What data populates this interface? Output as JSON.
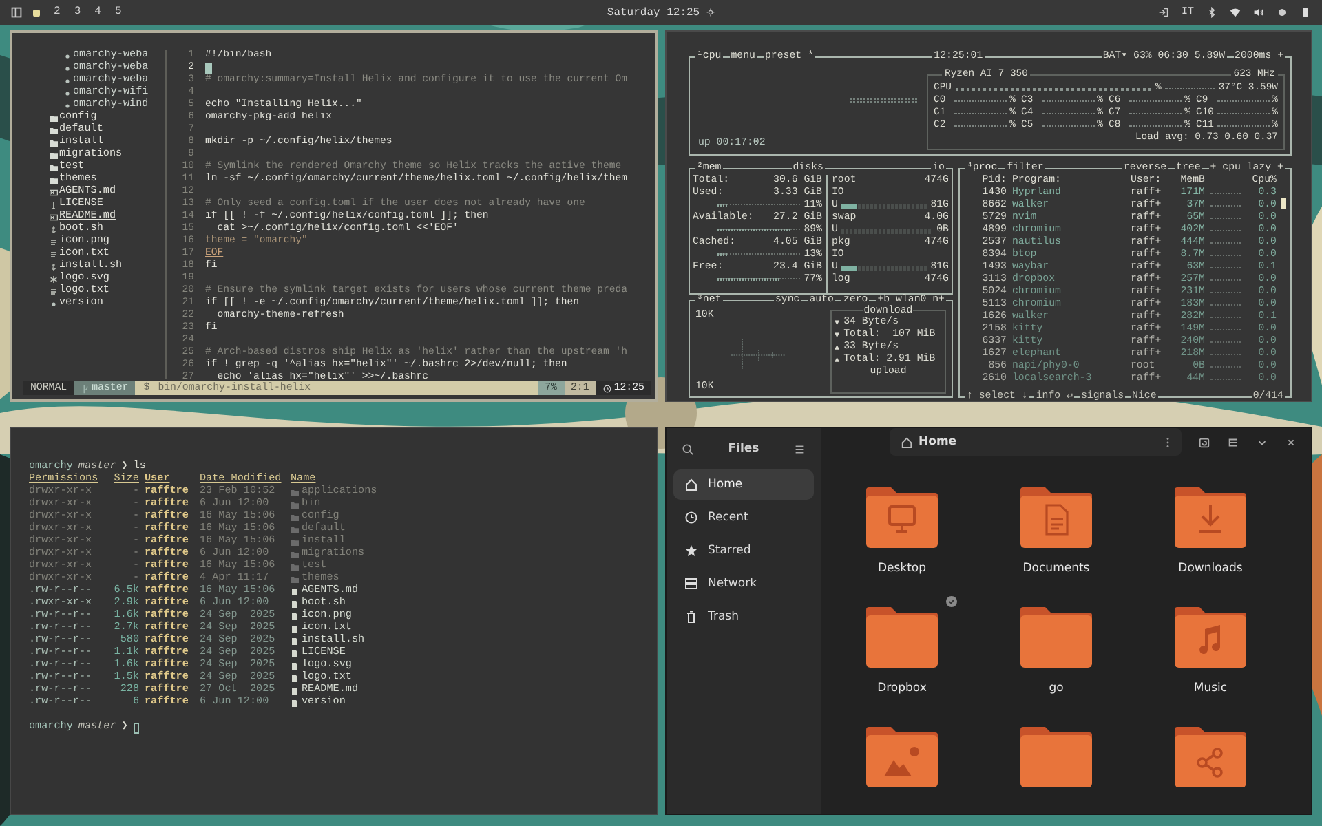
{
  "topbar": {
    "workspaces": [
      {
        "selected": true
      },
      {
        "label": "2",
        "selected": false
      },
      {
        "label": "3",
        "selected": false
      },
      {
        "label": "4",
        "selected": false
      },
      {
        "label": "5",
        "selected": false
      }
    ],
    "clock": "Saturday 12:25",
    "keyboard_layout": "IT"
  },
  "editor": {
    "tree": {
      "partial_children": [
        {
          "name": "omarchy-weba"
        },
        {
          "name": "omarchy-weba"
        },
        {
          "name": "omarchy-weba"
        },
        {
          "name": "omarchy-wifi"
        },
        {
          "name": "omarchy-wind"
        }
      ],
      "items": [
        {
          "name": "config",
          "kind": "folder"
        },
        {
          "name": "default",
          "kind": "folder"
        },
        {
          "name": "install",
          "kind": "folder"
        },
        {
          "name": "migrations",
          "kind": "folder"
        },
        {
          "name": "test",
          "kind": "folder"
        },
        {
          "name": "themes",
          "kind": "folder"
        },
        {
          "name": "AGENTS.md",
          "kind": "markdown"
        },
        {
          "name": "LICENSE",
          "kind": "license"
        },
        {
          "name": "README.md",
          "kind": "readme"
        },
        {
          "name": "boot.sh",
          "kind": "shell"
        },
        {
          "name": "icon.png"
        },
        {
          "name": "icon.txt",
          "kind": "text"
        },
        {
          "name": "install.sh",
          "kind": "shell"
        },
        {
          "name": "logo.svg",
          "kind": "svg"
        },
        {
          "name": "logo.txt",
          "kind": "text"
        },
        {
          "name": "version",
          "kind": "file"
        }
      ]
    },
    "lines": [
      {
        "number": "1",
        "text": "#!/bin/bash",
        "kind": "code",
        "current": false
      },
      {
        "number": "2",
        "current": true
      },
      {
        "number": "3",
        "text": "# omarchy:summary=Install Helix and configure it to use the current Om",
        "kind": "comment",
        "current": false
      },
      {
        "number": "4",
        "current": false
      },
      {
        "number": "5",
        "text": "echo \"Installing Helix...\"",
        "kind": "code",
        "current": false
      },
      {
        "number": "6",
        "text": "omarchy-pkg-add helix",
        "kind": "code",
        "current": false
      },
      {
        "number": "7",
        "current": false
      },
      {
        "number": "8",
        "text": "mkdir -p ~/.config/helix/themes",
        "kind": "code",
        "current": false
      },
      {
        "number": "9",
        "current": false
      },
      {
        "number": "10",
        "text": "# Symlink the rendered Omarchy theme so Helix tracks the active theme",
        "kind": "comment",
        "current": false
      },
      {
        "number": "11",
        "text": "ln -sf ~/.config/omarchy/current/theme/helix.toml ~/.config/helix/them",
        "kind": "code",
        "current": false
      },
      {
        "number": "12",
        "current": false
      },
      {
        "number": "13",
        "text": "# Only seed a config.toml if the user does not already have one",
        "kind": "comment",
        "current": false
      },
      {
        "number": "14",
        "text": "if [[ ! -f ~/.config/helix/config.toml ]]; then",
        "kind": "code",
        "current": false
      },
      {
        "number": "15",
        "text": "  cat >~/.config/helix/config.toml <<'EOF'",
        "kind": "code",
        "current": false
      },
      {
        "number": "16",
        "text": "theme = \"omarchy\"",
        "kind": "string",
        "current": false
      },
      {
        "number": "17",
        "text": "EOF",
        "kind": "heredoc",
        "current": false
      },
      {
        "number": "18",
        "text": "fi",
        "kind": "code",
        "current": false
      },
      {
        "number": "19",
        "current": false
      },
      {
        "number": "20",
        "text": "# Ensure the symlink target exists for users whose current theme preda",
        "kind": "comment",
        "current": false
      },
      {
        "number": "21",
        "text": "if [[ ! -e ~/.config/omarchy/current/theme/helix.toml ]]; then",
        "kind": "code",
        "current": false
      },
      {
        "number": "22",
        "text": "  omarchy-theme-refresh",
        "kind": "code",
        "current": false
      },
      {
        "number": "23",
        "text": "fi",
        "kind": "code",
        "current": false
      },
      {
        "number": "24",
        "current": false
      },
      {
        "number": "25",
        "text": "# Arch-based distros ship Helix as 'helix' rather than the upstream 'h",
        "kind": "comment",
        "current": false
      },
      {
        "number": "26",
        "text": "if ! grep -q '^alias hx=\"helix\"' ~/.bashrc 2>/dev/null; then",
        "kind": "code",
        "current": false
      },
      {
        "number": "27",
        "text": "  echo 'alias hx=\"helix\"' >>~/.bashrc",
        "kind": "code",
        "current": false
      }
    ],
    "status": {
      "mode": "NORMAL",
      "branch": "master",
      "file_icon": "$",
      "file": "bin/omarchy-install-helix",
      "percent": "7%",
      "position": "2:1",
      "time": "12:25"
    }
  },
  "btop": {
    "cpu": {
      "title": "¹cpu",
      "menu": "menu",
      "preset": "preset *",
      "time": "12:25:01",
      "battery": "BAT▾ 63% 06:30 5.89W",
      "interval": "2000ms +",
      "uptime": "up 00:17:02",
      "model": "Ryzen AI 7 350",
      "frequency": "623 MHz",
      "total_label": "CPU",
      "total_reading": "%",
      "temperature": "37°C 3.59W",
      "cores": [
        {
          "name": "C0",
          "reading": "%"
        },
        {
          "name": "C1",
          "reading": "%"
        },
        {
          "name": "C2",
          "reading": "%"
        },
        {
          "name": "C3",
          "reading": "%"
        },
        {
          "name": "C4",
          "reading": "%"
        },
        {
          "name": "C5",
          "reading": "%"
        },
        {
          "name": "C6",
          "reading": "%"
        },
        {
          "name": "C7",
          "reading": "%"
        },
        {
          "name": "C8",
          "reading": "%"
        },
        {
          "name": "C9",
          "reading": "%"
        },
        {
          "name": "C10",
          "reading": "%"
        },
        {
          "name": "C11",
          "reading": "%"
        }
      ],
      "load": "Load avg: 0.73 0.60 0.37"
    },
    "mem": {
      "title": "²mem",
      "rows": [
        {
          "label": "Total:",
          "value": "30.6 GiB"
        },
        {
          "label": "Used:",
          "value": "3.33 GiB",
          "percent": "11%",
          "level": 0.11
        },
        {
          "label": "Available:",
          "value": "27.2 GiB",
          "percent": "89%",
          "level": 0.89
        },
        {
          "label": "Cached:",
          "value": "4.05 GiB",
          "percent": "13%",
          "level": 0.13
        },
        {
          "label": "Free:",
          "value": "23.4 GiB",
          "percent": "77%",
          "level": 0.77
        }
      ]
    },
    "disks": {
      "title": "disks",
      "io_title": "io",
      "items": [
        {
          "name": "root",
          "size": "474G",
          "io": "IO",
          "usage_label": "U",
          "usage": "81G",
          "level": 0.17
        },
        {
          "name": "swap",
          "size": "4.0G",
          "usage_label": "U",
          "usage": "0B"
        },
        {
          "name": "pkg",
          "size": "474G",
          "io": "IO",
          "usage_label": "U",
          "usage": "81G",
          "level": 0.17
        },
        {
          "name": "log",
          "size": "474G"
        }
      ]
    },
    "net": {
      "title": "³net",
      "options": [
        "sync",
        "auto",
        "zero"
      ],
      "interface": "+b wlan0 n+",
      "scale_top": "10K",
      "scale_bottom": "10K",
      "download_title": "download",
      "upload_title": "upload",
      "stats": [
        {
          "arrow": "▼",
          "text": "34 Byte/s"
        },
        {
          "arrow": "▼",
          "text": "Total:  107 MiB"
        },
        {
          "arrow": "▲",
          "text": "33 Byte/s"
        },
        {
          "arrow": "▲",
          "text": "Total: 2.91 MiB"
        }
      ]
    },
    "proc": {
      "title": "⁴proc",
      "filter": "filter",
      "reverse": "reverse",
      "tree": "tree",
      "sort": "+ cpu lazy +",
      "columns": [
        "Pid:",
        "Program:",
        "User:",
        "MemB",
        "Cpu%"
      ],
      "rows": [
        {
          "pid": "1430",
          "program": "Hyprland",
          "user": "raff+",
          "mem": "171M",
          "cpu": "0.3"
        },
        {
          "pid": "8662",
          "program": "walker",
          "user": "raff+",
          "mem": "37M",
          "cpu": "0.0"
        },
        {
          "pid": "5729",
          "program": "nvim",
          "user": "raff+",
          "mem": "65M",
          "cpu": "0.0"
        },
        {
          "pid": "4899",
          "program": "chromium",
          "user": "raff+",
          "mem": "402M",
          "cpu": "0.0"
        },
        {
          "pid": "2537",
          "program": "nautilus",
          "user": "raff+",
          "mem": "444M",
          "cpu": "0.0"
        },
        {
          "pid": "8394",
          "program": "btop",
          "user": "raff+",
          "mem": "8.7M",
          "cpu": "0.0"
        },
        {
          "pid": "1493",
          "program": "waybar",
          "user": "raff+",
          "mem": "63M",
          "cpu": "0.1"
        },
        {
          "pid": "3113",
          "program": "dropbox",
          "user": "raff+",
          "mem": "257M",
          "cpu": "0.0"
        },
        {
          "pid": "5024",
          "program": "chromium",
          "user": "raff+",
          "mem": "231M",
          "cpu": "0.0"
        },
        {
          "pid": "5113",
          "program": "chromium",
          "user": "raff+",
          "mem": "183M",
          "cpu": "0.0"
        },
        {
          "pid": "1626",
          "program": "walker",
          "user": "raff+",
          "mem": "282M",
          "cpu": "0.1"
        },
        {
          "pid": "2158",
          "program": "kitty",
          "user": "raff+",
          "mem": "149M",
          "cpu": "0.0"
        },
        {
          "pid": "6337",
          "program": "kitty",
          "user": "raff+",
          "mem": "240M",
          "cpu": "0.0"
        },
        {
          "pid": "1627",
          "program": "elephant",
          "user": "raff+",
          "mem": "218M",
          "cpu": "0.0"
        },
        {
          "pid": "856",
          "program": "napi/phy0-0",
          "user": "root",
          "mem": "0B",
          "cpu": "0.0"
        },
        {
          "pid": "2610",
          "program": "localsearch-3",
          "user": "raff+",
          "mem": "44M",
          "cpu": "0.0"
        }
      ],
      "footer": [
        "↑ select ↓",
        "info ↵",
        "signals",
        "Nice"
      ],
      "count": "0/414"
    }
  },
  "terminal": {
    "prompt_user": "omarchy",
    "prompt_branch": "master",
    "prompt_symbol": "❯",
    "command": "ls",
    "next_prompt": {
      "user": "omarchy",
      "branch": "master",
      "symbol": "❯"
    },
    "columns": [
      "Permissions",
      "Size",
      "User",
      "Date Modified",
      "Name"
    ],
    "rows": [
      {
        "permissions": "drwxr-xr-x",
        "size": "-",
        "user": "rafftre",
        "date": "23 Feb 10:52",
        "name": "applications",
        "kind": "dir"
      },
      {
        "permissions": "drwxr-xr-x",
        "size": "-",
        "user": "rafftre",
        "date": "6 Jun 12:00",
        "name": "bin",
        "kind": "dir"
      },
      {
        "permissions": "drwxr-xr-x",
        "size": "-",
        "user": "rafftre",
        "date": "16 May 15:06",
        "name": "config",
        "kind": "dir"
      },
      {
        "permissions": "drwxr-xr-x",
        "size": "-",
        "user": "rafftre",
        "date": "16 May 15:06",
        "name": "default",
        "kind": "dir"
      },
      {
        "permissions": "drwxr-xr-x",
        "size": "-",
        "user": "rafftre",
        "date": "16 May 15:06",
        "name": "install",
        "kind": "dir"
      },
      {
        "permissions": "drwxr-xr-x",
        "size": "-",
        "user": "rafftre",
        "date": "6 Jun 12:00",
        "name": "migrations",
        "kind": "dir"
      },
      {
        "permissions": "drwxr-xr-x",
        "size": "-",
        "user": "rafftre",
        "date": "16 May 15:06",
        "name": "test",
        "kind": "dir"
      },
      {
        "permissions": "drwxr-xr-x",
        "size": "-",
        "user": "rafftre",
        "date": "4 Apr 11:17",
        "name": "themes",
        "kind": "dir"
      },
      {
        "permissions": ".rw-r--r--",
        "size": "6.5k",
        "user": "rafftre",
        "date": "16 May 15:06",
        "name": "AGENTS.md",
        "kind": "file"
      },
      {
        "permissions": ".rwxr-xr-x",
        "size": "2.9k",
        "user": "rafftre",
        "date": "6 Jun 12:00",
        "name": "boot.sh",
        "kind": "file"
      },
      {
        "permissions": ".rw-r--r--",
        "size": "1.6k",
        "user": "rafftre",
        "date": "24 Sep  2025",
        "name": "icon.png",
        "kind": "file"
      },
      {
        "permissions": ".rw-r--r--",
        "size": "2.7k",
        "user": "rafftre",
        "date": "24 Sep  2025",
        "name": "icon.txt",
        "kind": "file"
      },
      {
        "permissions": ".rw-r--r--",
        "size": "580",
        "user": "rafftre",
        "date": "24 Sep  2025",
        "name": "install.sh",
        "kind": "file"
      },
      {
        "permissions": ".rw-r--r--",
        "size": "1.1k",
        "user": "rafftre",
        "date": "24 Sep  2025",
        "name": "LICENSE",
        "kind": "file"
      },
      {
        "permissions": ".rw-r--r--",
        "size": "1.6k",
        "user": "rafftre",
        "date": "24 Sep  2025",
        "name": "logo.svg",
        "kind": "file"
      },
      {
        "permissions": ".rw-r--r--",
        "size": "1.5k",
        "user": "rafftre",
        "date": "24 Sep  2025",
        "name": "logo.txt",
        "kind": "file"
      },
      {
        "permissions": ".rw-r--r--",
        "size": "228",
        "user": "rafftre",
        "date": "27 Oct  2025",
        "name": "README.md",
        "kind": "file"
      },
      {
        "permissions": ".rw-r--r--",
        "size": "6",
        "user": "rafftre",
        "date": "6 Jun 12:00",
        "name": "version",
        "kind": "file"
      }
    ]
  },
  "files": {
    "title": "Files",
    "path": "Home",
    "places": [
      {
        "label": "Home",
        "kind": "home",
        "selected": true
      },
      {
        "label": "Recent",
        "kind": "recent",
        "selected": false
      },
      {
        "label": "Starred",
        "kind": "starred",
        "selected": false
      },
      {
        "label": "Network",
        "kind": "network",
        "selected": false
      },
      {
        "label": "Trash",
        "kind": "trash",
        "selected": false
      }
    ],
    "folders": [
      {
        "name": "Desktop",
        "kind": "desktop",
        "synced": false
      },
      {
        "name": "Documents",
        "kind": "documents",
        "synced": false
      },
      {
        "name": "Downloads",
        "kind": "downloads",
        "synced": false
      },
      {
        "name": "Dropbox",
        "kind": "plain",
        "synced": true
      },
      {
        "name": "go",
        "kind": "plain",
        "synced": false
      },
      {
        "name": "Music",
        "kind": "music",
        "synced": false
      },
      {
        "kind": "pictures",
        "synced": false
      },
      {
        "kind": "plain",
        "synced": false
      },
      {
        "kind": "public",
        "synced": false
      }
    ]
  }
}
